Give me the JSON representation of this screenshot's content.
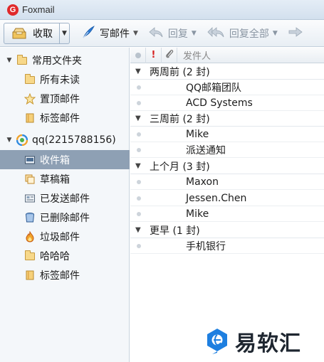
{
  "window": {
    "title": "Foxmail",
    "logo_letter": "G"
  },
  "toolbar": {
    "receive_label": "收取",
    "compose_label": "写邮件",
    "reply_label": "回复",
    "reply_all_label": "回复全部"
  },
  "sidebar": {
    "common_folder_label": "常用文件夹",
    "common_items": [
      {
        "label": "所有未读",
        "icon": "folder-icon"
      },
      {
        "label": "置顶邮件",
        "icon": "star-icon"
      },
      {
        "label": "标签邮件",
        "icon": "tag-icon"
      }
    ],
    "account_label": "qq(2215788156)",
    "account_items": [
      {
        "label": "收件箱",
        "icon": "inbox-icon",
        "selected": true
      },
      {
        "label": "草稿箱",
        "icon": "drafts-icon"
      },
      {
        "label": "已发送邮件",
        "icon": "sent-icon"
      },
      {
        "label": "已删除邮件",
        "icon": "trash-icon"
      },
      {
        "label": "垃圾邮件",
        "icon": "junk-fire-icon"
      },
      {
        "label": "哈哈哈",
        "icon": "folder-icon"
      },
      {
        "label": "标签邮件",
        "icon": "tag-icon"
      }
    ]
  },
  "message_list": {
    "columns": {
      "flag": "!",
      "attachment": "attachment-icon",
      "sender": "发件人"
    },
    "groups": [
      {
        "label": "两周前 (2 封)",
        "senders": [
          "QQ邮箱团队",
          "ACD Systems"
        ]
      },
      {
        "label": "三周前 (2 封)",
        "senders": [
          "Mike",
          "派送通知"
        ]
      },
      {
        "label": "上个月 (3 封)",
        "senders": [
          "Maxon",
          "Jessen.Chen",
          "Mike"
        ]
      },
      {
        "label": "更早 (1 封)",
        "senders": [
          "手机银行"
        ]
      }
    ]
  },
  "watermark": {
    "text": "易软汇"
  },
  "colors": {
    "selected_row": "#8ea0b4",
    "sidebar_bg": "#f4f7fa",
    "flag_red": "#d62020",
    "compose_blue": "#2a7bd6",
    "watermark_blue": "#1e7fe0"
  }
}
